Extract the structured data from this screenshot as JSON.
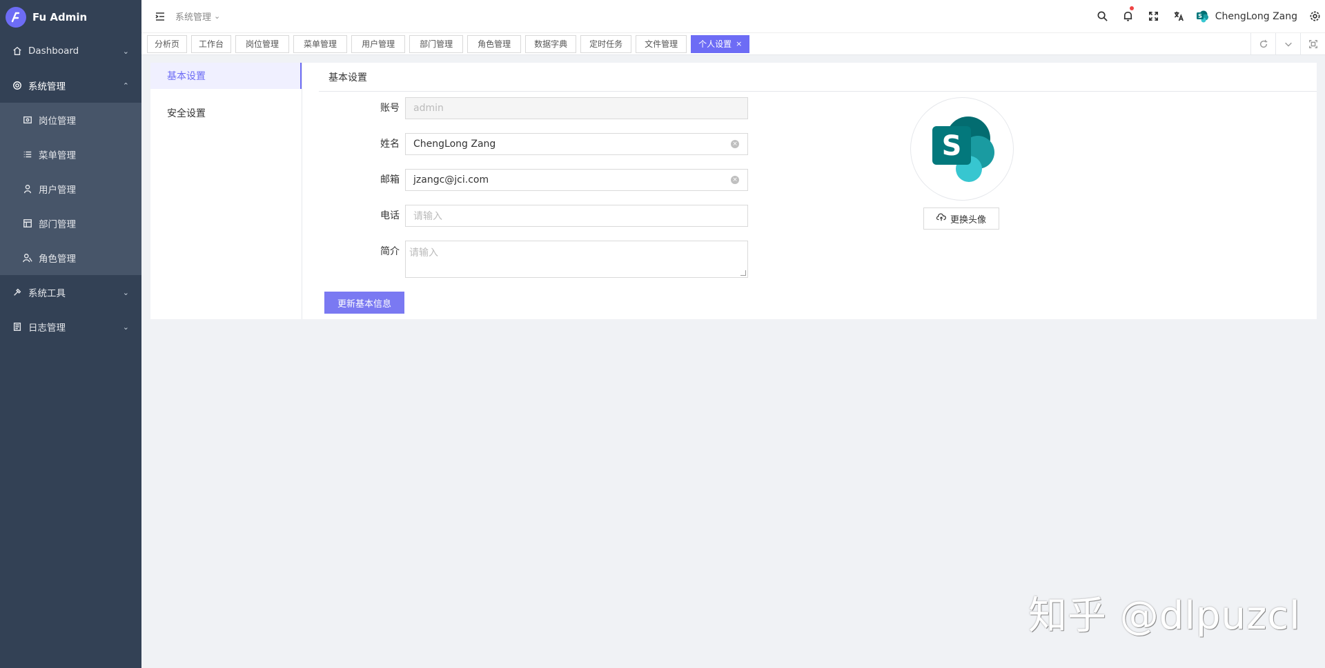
{
  "brand": {
    "name": "Fu Admin",
    "logo_icon": "logo-icon"
  },
  "sidebar": {
    "items": [
      {
        "label": "Dashboard",
        "icon": "home-icon"
      },
      {
        "label": "系统管理",
        "icon": "gear-icon"
      },
      {
        "label": "岗位管理",
        "icon": "post-icon"
      },
      {
        "label": "菜单管理",
        "icon": "list-icon"
      },
      {
        "label": "用户管理",
        "icon": "user-icon"
      },
      {
        "label": "部门管理",
        "icon": "department-icon"
      },
      {
        "label": "角色管理",
        "icon": "role-icon"
      },
      {
        "label": "系统工具",
        "icon": "tool-icon"
      },
      {
        "label": "日志管理",
        "icon": "log-icon"
      }
    ]
  },
  "header": {
    "breadcrumb": "系统管理",
    "user_name": "ChengLong Zang"
  },
  "tabs": [
    "分析页",
    "工作台",
    "岗位管理",
    "菜单管理",
    "用户管理",
    "部门管理",
    "角色管理",
    "数据字典",
    "定时任务",
    "文件管理",
    "个人设置"
  ],
  "tab_close": "×",
  "settings_nav": {
    "basic": "基本设置",
    "security": "安全设置"
  },
  "panel": {
    "title": "基本设置"
  },
  "form": {
    "account_label": "账号",
    "account_value": "admin",
    "name_label": "姓名",
    "name_value": "ChengLong Zang",
    "email_label": "邮箱",
    "email_value": "jzangc@jci.com",
    "phone_label": "电话",
    "phone_placeholder": "请输入",
    "intro_label": "简介",
    "intro_placeholder": "请输入",
    "submit_label": "更新基本信息"
  },
  "avatar": {
    "change_label": "更换头像"
  },
  "watermark": "知乎 @dlpuzcl",
  "colors": {
    "primary": "#6d6cf5",
    "sidebar_bg": "#334155",
    "submenu_bg": "#475569"
  }
}
